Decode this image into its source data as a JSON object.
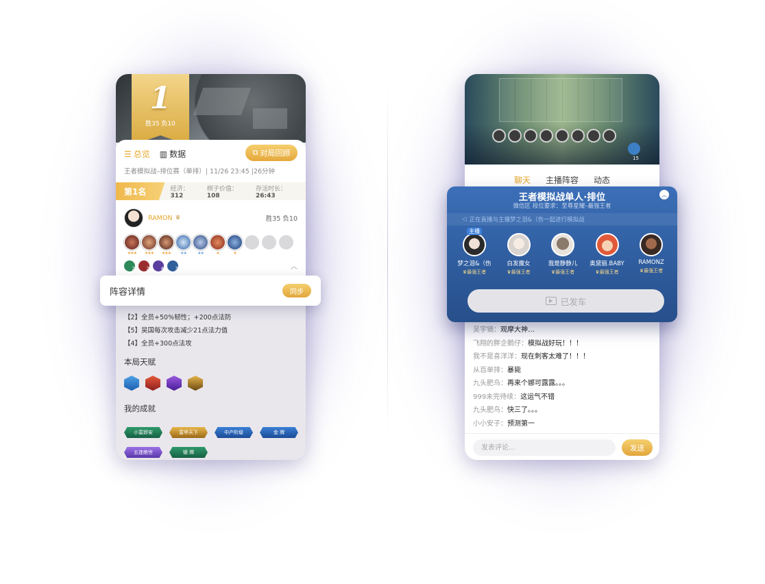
{
  "left": {
    "rank_number": "1",
    "rank_record": "胜35 负10",
    "tabs": [
      {
        "label": "总览"
      },
      {
        "label": "数据"
      }
    ],
    "review_button": "对局回顾",
    "match_info": "王者模拟战–排位赛（单排）| 11/26 23:45 |26分钟",
    "place": "第1名",
    "stats": [
      {
        "label": "经济：",
        "value": "312"
      },
      {
        "label": "棋子价值：",
        "value": "108"
      },
      {
        "label": "存活时长：",
        "value": "26:43"
      }
    ],
    "player": {
      "name": "RAMON",
      "record": "胜35  负10"
    },
    "equips": [
      "2",
      "2",
      "4",
      "3"
    ],
    "popup": {
      "title": "阵容详情",
      "sync_button": "同步"
    },
    "buffs": [
      "【2】全员+50%韧性；+200点法防",
      "【5】吴国每次攻击减少21点法力值",
      "【4】全员+300点法攻"
    ],
    "talent_title": "本局天赋",
    "achievement_title": "我的成就",
    "achievements": [
      "小富即安",
      "富甲天下",
      "中产阶级",
      "金  牌",
      "五连绝世",
      "银  牌"
    ]
  },
  "right": {
    "coin_count": "15",
    "tabs": [
      {
        "label": "聊天"
      },
      {
        "label": "主播阵容"
      },
      {
        "label": "动态"
      }
    ],
    "popup": {
      "title": "王者模拟战单人·排位",
      "subtitle": "微信区  段位要求：至尊星耀–最强王者",
      "notice": "正在直播与主播梦之泪&（伤一起进行模拟战",
      "host_label": "主播",
      "members": [
        {
          "name": "梦之泪&（伤",
          "rank": "最强王者"
        },
        {
          "name": "白发魔女",
          "rank": "最强王者"
        },
        {
          "name": "我是静静儿",
          "rank": "最强王者"
        },
        {
          "name": "奥黛丽.BABY",
          "rank": "最强王者"
        },
        {
          "name": "RAMONZ",
          "rank": "最强王者"
        }
      ],
      "launched_label": "已发车"
    },
    "chat": [
      {
        "user": "吴宇镝：",
        "msg": "观摩大神…"
      },
      {
        "user": "飞翔的胖企鹅仔：",
        "msg": "模拟战好玩！！！"
      },
      {
        "user": "我不是喜洋洋：",
        "msg": "现在刺客太难了！！！"
      },
      {
        "user": "从百单排：",
        "msg": "暴毙"
      },
      {
        "user": "九头肥鸟：",
        "msg": "再来个娜可露露。。。"
      },
      {
        "user": "999未完待续：",
        "msg": "这运气不错"
      },
      {
        "user": "九头肥鸟：",
        "msg": "快三了。。。"
      },
      {
        "user": "小小安子：",
        "msg": "预测第一"
      }
    ],
    "comment_placeholder": "发表评论...",
    "send_button": "发送"
  }
}
